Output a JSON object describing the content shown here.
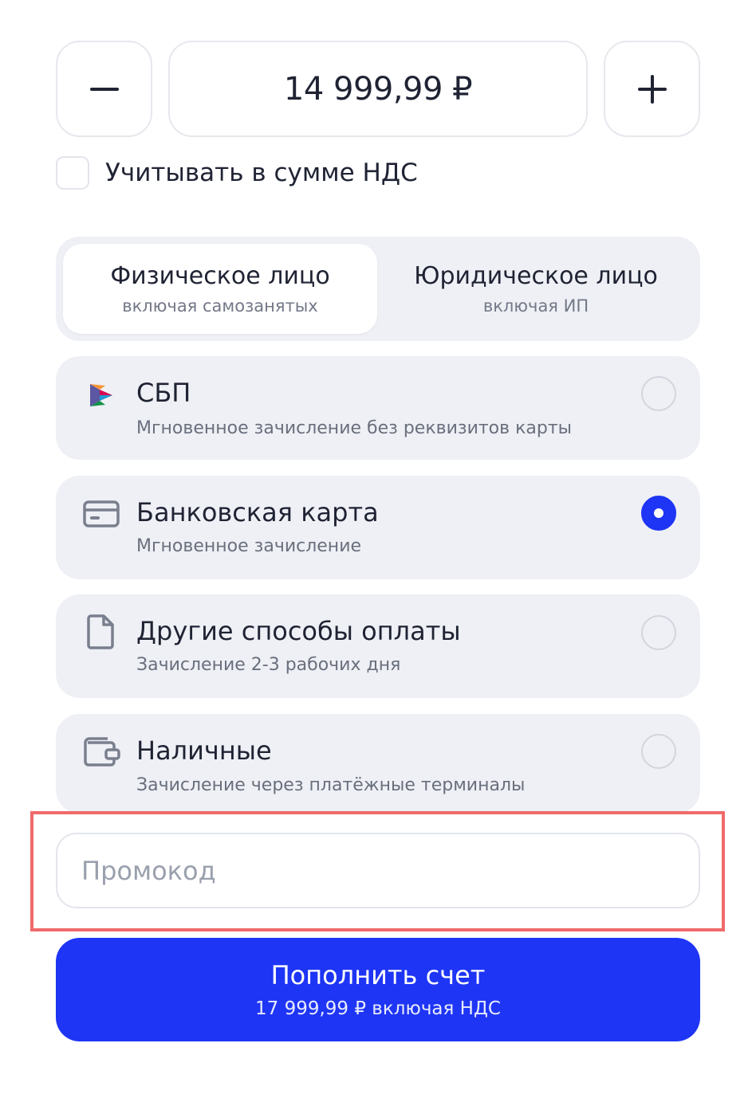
{
  "amount": {
    "value": "14 999,99 ₽",
    "decrease_icon": "minus-icon",
    "increase_icon": "plus-icon"
  },
  "vat": {
    "label": "Учитывать в сумме НДС",
    "checked": false
  },
  "entity": {
    "options": [
      {
        "title": "Физическое лицо",
        "subtitle": "включая самозанятых",
        "selected": true
      },
      {
        "title": "Юридическое лицо",
        "subtitle": "включая ИП",
        "selected": false
      }
    ]
  },
  "payment": {
    "options": [
      {
        "icon": "sbp-icon",
        "title": "СБП",
        "subtitle": "Мгновенное зачисление без реквизитов карты",
        "selected": false
      },
      {
        "icon": "bank-card-icon",
        "title": "Банковская карта",
        "subtitle": "Мгновенное зачисление",
        "selected": true
      },
      {
        "icon": "document-icon",
        "title": "Другие способы оплаты",
        "subtitle": "Зачисление 2-3 рабочих дня",
        "selected": false
      },
      {
        "icon": "wallet-icon",
        "title": "Наличные",
        "subtitle": "Зачисление через платёжные терминалы",
        "selected": false
      }
    ]
  },
  "promo": {
    "placeholder": "Промокод",
    "value": ""
  },
  "submit": {
    "title": "Пополнить счет",
    "subtitle": "17 999,99 ₽ включая НДС"
  },
  "colors": {
    "accent": "#1e35f5",
    "highlight": "#ef6a6a",
    "card_background": "#eef0f5"
  }
}
